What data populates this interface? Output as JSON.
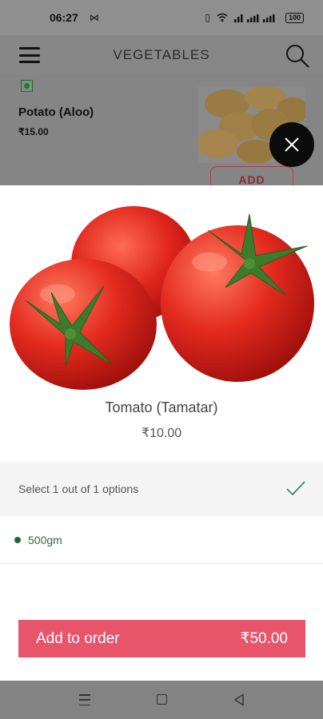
{
  "status_bar": {
    "time": "06:27",
    "battery": "100"
  },
  "header": {
    "title": "VEGETABLES"
  },
  "background_item": {
    "name": "Potato  (Aloo)",
    "price": "₹15.00",
    "add_label": "ADD"
  },
  "product": {
    "name": "Tomato (Tamatar)",
    "price": "₹10.00"
  },
  "options": {
    "prompt": "Select 1 out of 1 options",
    "items": [
      {
        "label": "500gm",
        "selected": true
      }
    ]
  },
  "order_button": {
    "label": "Add to order",
    "total": "₹50.00"
  },
  "colors": {
    "accent": "#e8546a",
    "veg_green": "#1f6b2e",
    "check_green": "#3a8a5a"
  },
  "icons": [
    "menu-icon",
    "search-icon",
    "close-icon",
    "check-icon",
    "nav-menu-icon",
    "nav-home-icon",
    "nav-back-icon"
  ]
}
